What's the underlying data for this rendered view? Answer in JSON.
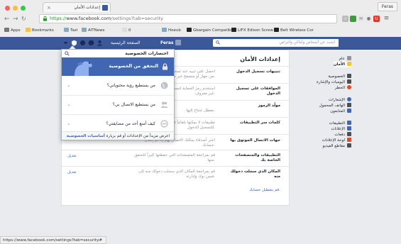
{
  "browser": {
    "tab_title": "إعدادات الأمان",
    "user_chip": "Feras",
    "url_secure": "https://",
    "url_host": "www.facebook.com",
    "url_path": "/settings?tab=security",
    "status_url": "https://www.facebook.com/settings?tab=security#",
    "bookmarks": [
      "Apps",
      "Bookmarks",
      "Tazi",
      "AlTNews",
      "0",
      "Hoeub",
      "Gbargain Compatib",
      "LIFX Edison Screw",
      "Belt Wireless Cor"
    ],
    "colors": {
      "close": "#fc605c",
      "minimize": "#fdbc40",
      "maximize": "#34c84a"
    }
  },
  "fb": {
    "search_placeholder": "ابحث عن أشخاص وأماكن وأغراض",
    "home_label": "الصفحة الرئيسية",
    "user_name": "Feras",
    "brand_color": "#3b5998"
  },
  "sidebar": {
    "items": [
      {
        "label": "عام",
        "icon": "gear-icon"
      },
      {
        "label": "الأمان",
        "icon": "shield-icon",
        "selected": true
      },
      {
        "label": "الخصوصية",
        "icon": "lock-icon"
      },
      {
        "label": "اليوميات والإشارة",
        "icon": "timeline-icon"
      },
      {
        "label": "الحظر",
        "icon": "block-icon"
      },
      {
        "label": "الإشعارات",
        "icon": "globe-icon"
      },
      {
        "label": "الهاتف المحمول",
        "icon": "mobile-icon"
      },
      {
        "label": "المتابعون",
        "icon": "rss-icon"
      },
      {
        "label": "التطبيقات",
        "icon": "apps-icon"
      },
      {
        "label": "الإعلانات",
        "icon": "ads-icon"
      },
      {
        "label": "دفعات",
        "icon": "card-icon"
      },
      {
        "label": "لوحة الإعلانات",
        "icon": "inbox-icon"
      },
      {
        "label": "مقاطع الفيديو",
        "icon": "video-icon"
      }
    ]
  },
  "main": {
    "title": "إعدادات الأمان",
    "rows": [
      {
        "label": "تنبيهات تسجيل الدخول",
        "desc": "احصل على تنبيه عند تسجيل الدخول إلى حسابك من جهاز أو متصفح غير معروف.",
        "edit": "تعديل"
      },
      {
        "label": "الموافقات على تسجيل الدخول",
        "desc": "استخدم رمز الحماية لتسجيل الدخول من متصفح غير معروف.",
        "edit": "تعديل"
      },
      {
        "label": "مولّد الرموز",
        "desc": "معطل تحتاج إليها.",
        "edit": "تعديل"
      },
      {
        "label": "كلمات سر التطبيقات",
        "desc": "تطبيقات لا يمكنها تلقائياً في استخدام كلمة سر للتسجيل الدخول.",
        "edit": "تعديل"
      },
      {
        "label": "جهات الاتصال الموثوق بها",
        "desc": "اختر أصدقاء يمكنك الاتصال بهم إذا تم إقفال حسابك.",
        "edit": "تعديل"
      },
      {
        "label": "التطبيقات والمتصفحات الخاصة بك",
        "desc": "قم بمراجعة المتصفحات التي حفظتها كثيراً للتحقق منها.",
        "edit": "تعديل"
      },
      {
        "label": "المكان الذي سجلت دخولك منه",
        "desc": "قم بمراجعة المكان الذي سجلت دخولك منه إلى فيس بوك وإدارته.",
        "edit": "تعديل"
      }
    ],
    "footer_link": "قم بتعطيل حسابك."
  },
  "dropdown": {
    "title": "اختصارات الخصوصية",
    "hero": "التحقق من الخصوصية",
    "items": [
      {
        "label": "من يستطيع رؤية محتوياتي؟",
        "icon": "globe-icon"
      },
      {
        "label": "من يستطيع الاتصال بي؟",
        "icon": "people-icon"
      },
      {
        "label": "كيف أمنع أحد من مضايقتي؟",
        "icon": "block-icon"
      }
    ],
    "footer_text": "اعرض مزيداً من الإعدادات أو قم بزيارة",
    "footer_link": "أساسيات الخصوصية"
  }
}
